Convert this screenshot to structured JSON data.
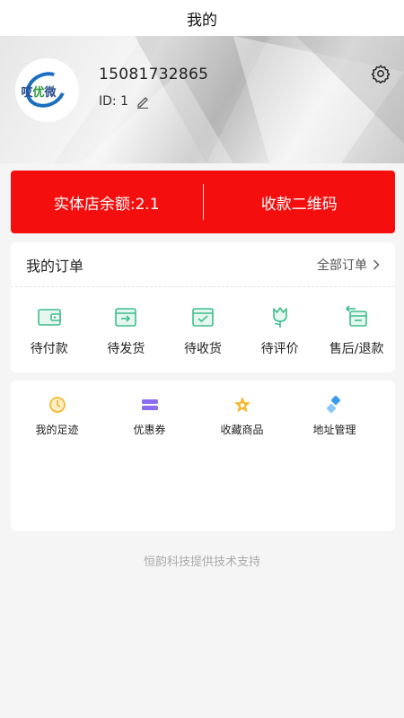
{
  "header": {
    "title": "我的"
  },
  "profile": {
    "phone": "15081732865",
    "id_text": "ID: 1",
    "avatar_logo_text_left": "哎",
    "avatar_logo_text_mid": "优",
    "avatar_logo_text_right": "微",
    "settings_icon": "gear-icon",
    "edit_icon": "pencil-icon"
  },
  "balance": {
    "store_balance": "实体店余额:2.1",
    "qr_code": "收款二维码",
    "color": "#f50e0e"
  },
  "orders": {
    "title": "我的订单",
    "all_label": "全部订单",
    "items": [
      {
        "label": "待付款",
        "icon": "wallet-icon"
      },
      {
        "label": "待发货",
        "icon": "box-send-icon"
      },
      {
        "label": "待收货",
        "icon": "box-check-icon"
      },
      {
        "label": "待评价",
        "icon": "flower-icon"
      },
      {
        "label": "售后/退款",
        "icon": "refund-icon"
      }
    ],
    "icon_color": "#3dbd8e"
  },
  "tools": {
    "items": [
      {
        "label": "我的足迹",
        "icon": "clock-icon",
        "color": "#f5b82e"
      },
      {
        "label": "优惠券",
        "icon": "coupon-icon",
        "color": "#8b6cf0"
      },
      {
        "label": "收藏商品",
        "icon": "star-icon",
        "color": "#f5b82e"
      },
      {
        "label": "地址管理",
        "icon": "map-pin-icon",
        "color": "#3a9cf0"
      }
    ]
  },
  "footer": {
    "text": "恒韵科技提供技术支持"
  }
}
